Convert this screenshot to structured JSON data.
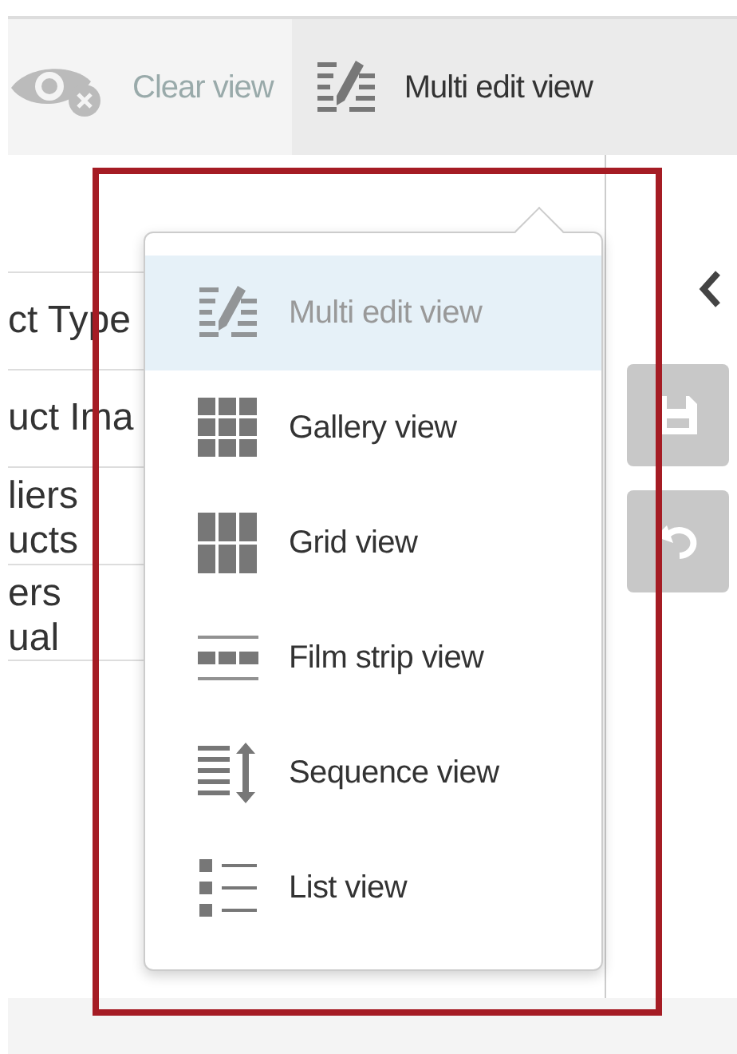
{
  "toolbar": {
    "buttons": [
      {
        "kind": "clear",
        "label": "Clear view",
        "selected": false
      },
      {
        "kind": "multi",
        "label": "Multi edit view",
        "selected": true
      }
    ]
  },
  "table": {
    "rows": [
      [
        "ct Type"
      ],
      [
        "uct Ima"
      ],
      [
        "liers",
        "ucts"
      ],
      [
        "ers",
        "ual"
      ]
    ]
  },
  "view_menu": {
    "items": [
      {
        "kind": "multi",
        "label": "Multi edit view",
        "selected": true
      },
      {
        "kind": "gallery",
        "label": "Gallery view",
        "selected": false
      },
      {
        "kind": "grid",
        "label": "Grid view",
        "selected": false
      },
      {
        "kind": "film",
        "label": "Film strip view",
        "selected": false
      },
      {
        "kind": "sequence",
        "label": "Sequence view",
        "selected": false
      },
      {
        "kind": "list",
        "label": "List view",
        "selected": false
      }
    ]
  },
  "side_buttons": [
    {
      "kind": "collapse"
    },
    {
      "kind": "save",
      "disabled": true
    },
    {
      "kind": "undo",
      "disabled": true
    }
  ]
}
